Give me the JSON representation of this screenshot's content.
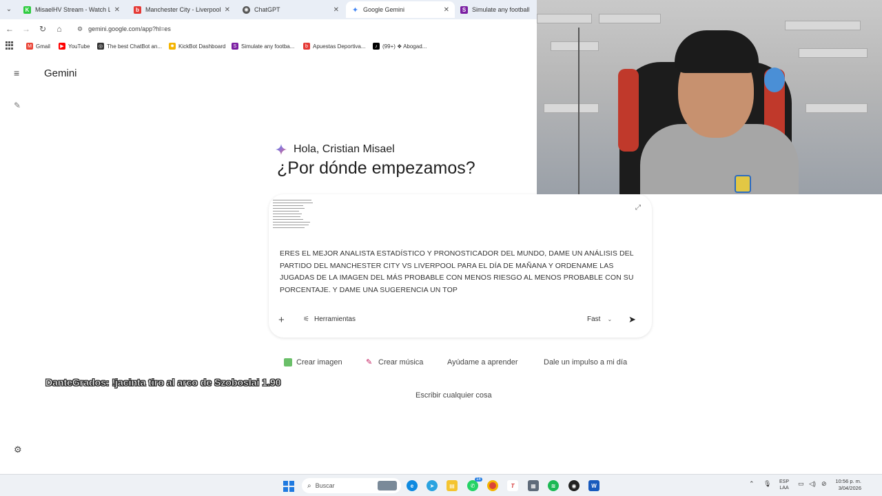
{
  "browser": {
    "tabs": [
      {
        "label": "MisaelHV Stream - Watch Live",
        "favicon_color": "#2ecc40",
        "active": false
      },
      {
        "label": "Manchester City - Liverpool FC",
        "favicon_color": "#e53935",
        "active": false
      },
      {
        "label": "ChatGPT",
        "favicon_color": "#555555",
        "active": false
      },
      {
        "label": "Google Gemini",
        "favicon_color": "#4285f4",
        "active": true
      },
      {
        "label": "Simulate any football match",
        "favicon_color": "#7b1fa2",
        "active": false
      }
    ],
    "url": "gemini.google.com/app?hl=es",
    "bookmarks": [
      {
        "label": "Gmail",
        "color": "#ea4335"
      },
      {
        "label": "YouTube",
        "color": "#ff0000"
      },
      {
        "label": "The best ChatBot an...",
        "color": "#333333"
      },
      {
        "label": "KickBot Dashboard",
        "color": "#f4b400"
      },
      {
        "label": "Simulate any footba...",
        "color": "#7b1fa2"
      },
      {
        "label": "Apuestas Deportiva...",
        "color": "#e53935"
      },
      {
        "label": "(99+) ❖ Abogad...",
        "color": "#000000"
      }
    ]
  },
  "gemini": {
    "brand": "Gemini",
    "greeting": "Hola, Cristian Misael",
    "headline": "¿Por dónde empezamos?",
    "prompt_text": "ERES EL MEJOR ANALISTA ESTADÍSTICO Y PRONOSTICADOR DEL MUNDO, DAME UN ANÁLISIS DEL PARTIDO DEL MANCHESTER CITY VS LIVERPOOL PARA EL DÍA DE MAÑANA Y ORDENAME LAS JUGADAS DE LA IMAGEN DEL MÁS PROBABLE CON MENOS RIESGO AL MENOS PROBABLE CON SU PORCENTAJE. Y DAME UNA SUGERENCIA UN TOP",
    "tools_label": "Herramientas",
    "mode_label": "Fast",
    "chips": [
      {
        "label": "Crear imagen",
        "icon": "image-icon"
      },
      {
        "label": "Crear música",
        "icon": "music-icon"
      },
      {
        "label": "Ayúdame a aprender",
        "icon": ""
      },
      {
        "label": "Dale un impulso a mi día",
        "icon": ""
      }
    ],
    "write_anything": "Escribir cualquier cosa"
  },
  "overlay": {
    "chat_message": "DanteGrados: !jacinta tiro al arco de Szoboslai 1.90"
  },
  "taskbar": {
    "search_placeholder": "Buscar",
    "language": "ESP",
    "language_sub": "LAA",
    "time": "10:56 p. m.",
    "date": "3/04/2026",
    "whatsapp_badge": "18"
  },
  "colors": {
    "accent": "#1a73e8",
    "tabbar_bg": "#e9eef6"
  }
}
